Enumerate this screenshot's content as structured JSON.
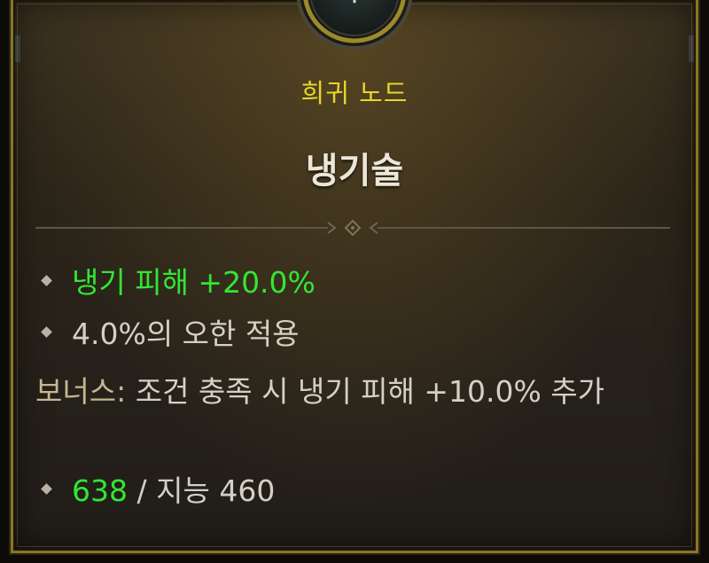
{
  "tooltip": {
    "rarity": "희귀 노드",
    "name": "냉기술",
    "effects": [
      {
        "text": "냉기 피해 +20.0%",
        "color": "#33e633"
      },
      {
        "text": "4.0%의 오한 적용",
        "color": "#d5d0c5"
      }
    ],
    "bonus_label": "보너스:",
    "bonus_text": "조건 충족 시 냉기 피해 +10.0% 추가",
    "requirement": {
      "current": "638",
      "separator": "/",
      "stat_label": "지능",
      "required": "460"
    }
  },
  "colors": {
    "rarity": "#e6d62a",
    "border": "#8a7720",
    "positive": "#33e633",
    "bonus_label": "#c9b592"
  },
  "icons": {
    "emblem": "paragon-node-emblem-icon",
    "divider": "ornament-divider-icon",
    "bullet": "diamond-bullet-icon"
  }
}
